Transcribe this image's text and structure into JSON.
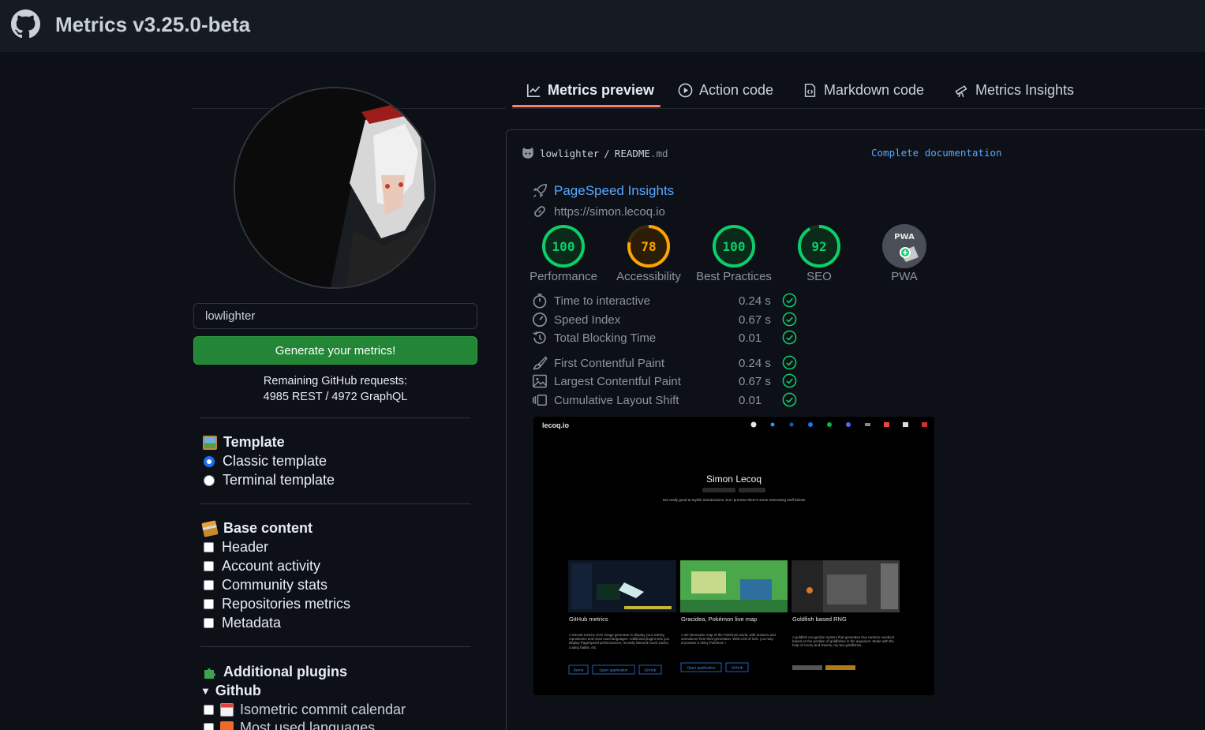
{
  "app": {
    "title": "Metrics v3.25.0-beta"
  },
  "sidebar": {
    "username_value": "lowlighter",
    "generate_label": "Generate your metrics!",
    "remaining_line1": "Remaining GitHub requests:",
    "remaining_line2": "4985 REST / 4972 GraphQL",
    "template_section": {
      "title": "Template",
      "options": [
        {
          "label": "Classic template",
          "checked": true
        },
        {
          "label": "Terminal template",
          "checked": false
        }
      ]
    },
    "base_section": {
      "title": "Base content",
      "options": [
        {
          "label": "Header"
        },
        {
          "label": "Account activity"
        },
        {
          "label": "Community stats"
        },
        {
          "label": "Repositories metrics"
        },
        {
          "label": "Metadata"
        }
      ]
    },
    "plugins_section": {
      "title": "Additional plugins",
      "group": "Github",
      "items": [
        {
          "label": "Isometric commit calendar"
        },
        {
          "label": "Most used languages"
        }
      ]
    }
  },
  "tabs": [
    {
      "label": "Metrics preview",
      "icon": "graph-icon",
      "active": true
    },
    {
      "label": "Action code",
      "icon": "play-icon",
      "active": false
    },
    {
      "label": "Markdown code",
      "icon": "code-file-icon",
      "active": false
    },
    {
      "label": "Metrics Insights",
      "icon": "telescope-icon",
      "active": false
    }
  ],
  "preview": {
    "repo_owner": "lowlighter",
    "separator": "/",
    "file_name": "README",
    "file_ext": ".md",
    "doc_link": "Complete documentation",
    "pagespeed": {
      "title": "PageSpeed Insights",
      "url": "https://simon.lecoq.io",
      "scores": [
        {
          "label": "Performance",
          "value": "100",
          "color": "#0cce6b"
        },
        {
          "label": "Accessibility",
          "value": "78",
          "color": "#ffa400"
        },
        {
          "label": "Best Practices",
          "value": "100",
          "color": "#0cce6b"
        },
        {
          "label": "SEO",
          "value": "92",
          "color": "#0cce6b"
        },
        {
          "label": "PWA",
          "value": "",
          "color": "#8b949e"
        }
      ],
      "pwa_badge": "PWA",
      "metrics": [
        {
          "label": "Time to interactive",
          "value": "0.24 s",
          "icon": "stopwatch-icon"
        },
        {
          "label": "Speed Index",
          "value": "0.67 s",
          "icon": "speedometer-icon"
        },
        {
          "label": "Total Blocking Time",
          "value": "0.01",
          "icon": "history-icon"
        },
        {
          "label": "First Contentful Paint",
          "value": "0.24 s",
          "icon": "paintbrush-icon"
        },
        {
          "label": "Largest Contentful Paint",
          "value": "0.67 s",
          "icon": "image-icon"
        },
        {
          "label": "Cumulative Layout Shift",
          "value": "0.01",
          "icon": "layers-icon"
        }
      ]
    },
    "site": {
      "brand": "lecoq.io",
      "name": "Simon Lecoq",
      "tagline": "Not really good at stylish introductions, but I promise there's some interesting stuff below!",
      "cards": [
        {
          "title": "GitHub metrics",
          "desc": "A GitHub metrics SVG image generator to display your activity, repositories and most used languages. Additional plugins lets you display PageSpeed performances, recently listened music tracks, coding habits, etc.",
          "buttons": [
            "Demo",
            "Open application",
            "GitHub"
          ]
        },
        {
          "title": "Gracidea, Pokémon live map",
          "desc": "A 2D interactive map of the Pokémon world, with textures and animations from third generation. With a bit of luck, you may encounter a shiny Pokémon !",
          "buttons": [
            "Open application",
            "GitHub"
          ]
        },
        {
          "title": "Goldfish based RNG",
          "desc": "A goldfish recognition system that generates true random numbers based on the position of goldfishes in the aquarium. Made with the help of Azerty and Gwerty, my two goldfishes.",
          "buttons": []
        }
      ]
    }
  }
}
